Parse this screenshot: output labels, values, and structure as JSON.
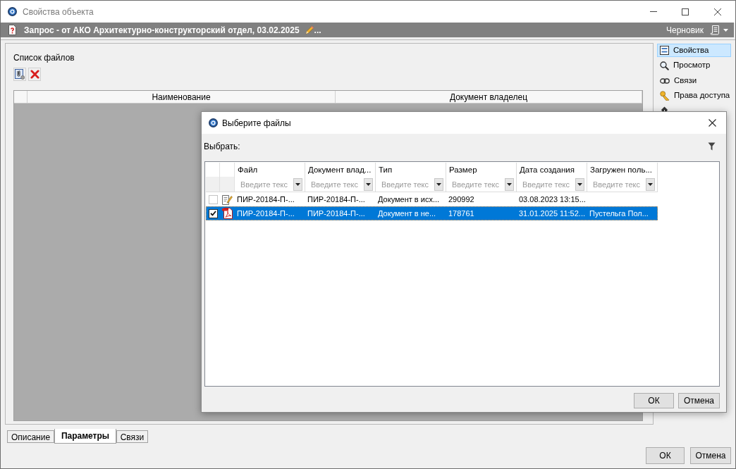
{
  "window": {
    "title": "Свойства объекта"
  },
  "object_header": {
    "title": "Запрос - от АКО Архитектурно-конструкторский отдел, 03.02.2025",
    "more": "...",
    "status": "Черновик"
  },
  "files_panel": {
    "label": "Список файлов",
    "table": {
      "columns": [
        "Наименование",
        "Документ владелец"
      ]
    }
  },
  "sidebar": {
    "items": [
      {
        "label": "Свойства",
        "kind": "properties",
        "selected": true
      },
      {
        "label": "Просмотр",
        "kind": "preview",
        "selected": false
      },
      {
        "label": "Связи",
        "kind": "links",
        "selected": false
      },
      {
        "label": "Права доступа",
        "kind": "access",
        "selected": false
      },
      {
        "kind": "signatures",
        "selected": false
      }
    ]
  },
  "tabs": [
    {
      "label": "Описание",
      "selected": false
    },
    {
      "label": "Параметры",
      "selected": true
    },
    {
      "label": "Связи",
      "selected": false
    }
  ],
  "buttons": [
    "ОК",
    "Отмена"
  ],
  "dialog": {
    "title": "Выберите файлы",
    "filter_label": "Выбрать:",
    "columns": [
      {
        "label": "Файл",
        "placeholder": "Введите текс"
      },
      {
        "label": "Документ влад...",
        "placeholder": "Введите текс"
      },
      {
        "label": "Тип",
        "placeholder": "Введите текс"
      },
      {
        "label": "Размер",
        "placeholder": "Введите текс"
      },
      {
        "label": "Дата создания",
        "placeholder": "Введите текс"
      },
      {
        "label": "Загружен поль...",
        "placeholder": "Введите текс"
      }
    ],
    "rows": [
      {
        "kind": "document",
        "checked": false,
        "selected": false,
        "cells": [
          "ПИР-20184-П-...",
          "ПИР-20184-П-...",
          "Документ в исх...",
          "290992",
          "03.08.2023 13:15..."
        ]
      },
      {
        "kind": "pdf",
        "checked": true,
        "selected": true,
        "cells": [
          "ПИР-20184-П-...",
          "ПИР-20184-П-...",
          "Документ в не...",
          "178761",
          "31.01.2025 11:52...",
          "Пустельга Пол..."
        ]
      }
    ],
    "buttons": [
      "ОК",
      "Отмена"
    ]
  }
}
